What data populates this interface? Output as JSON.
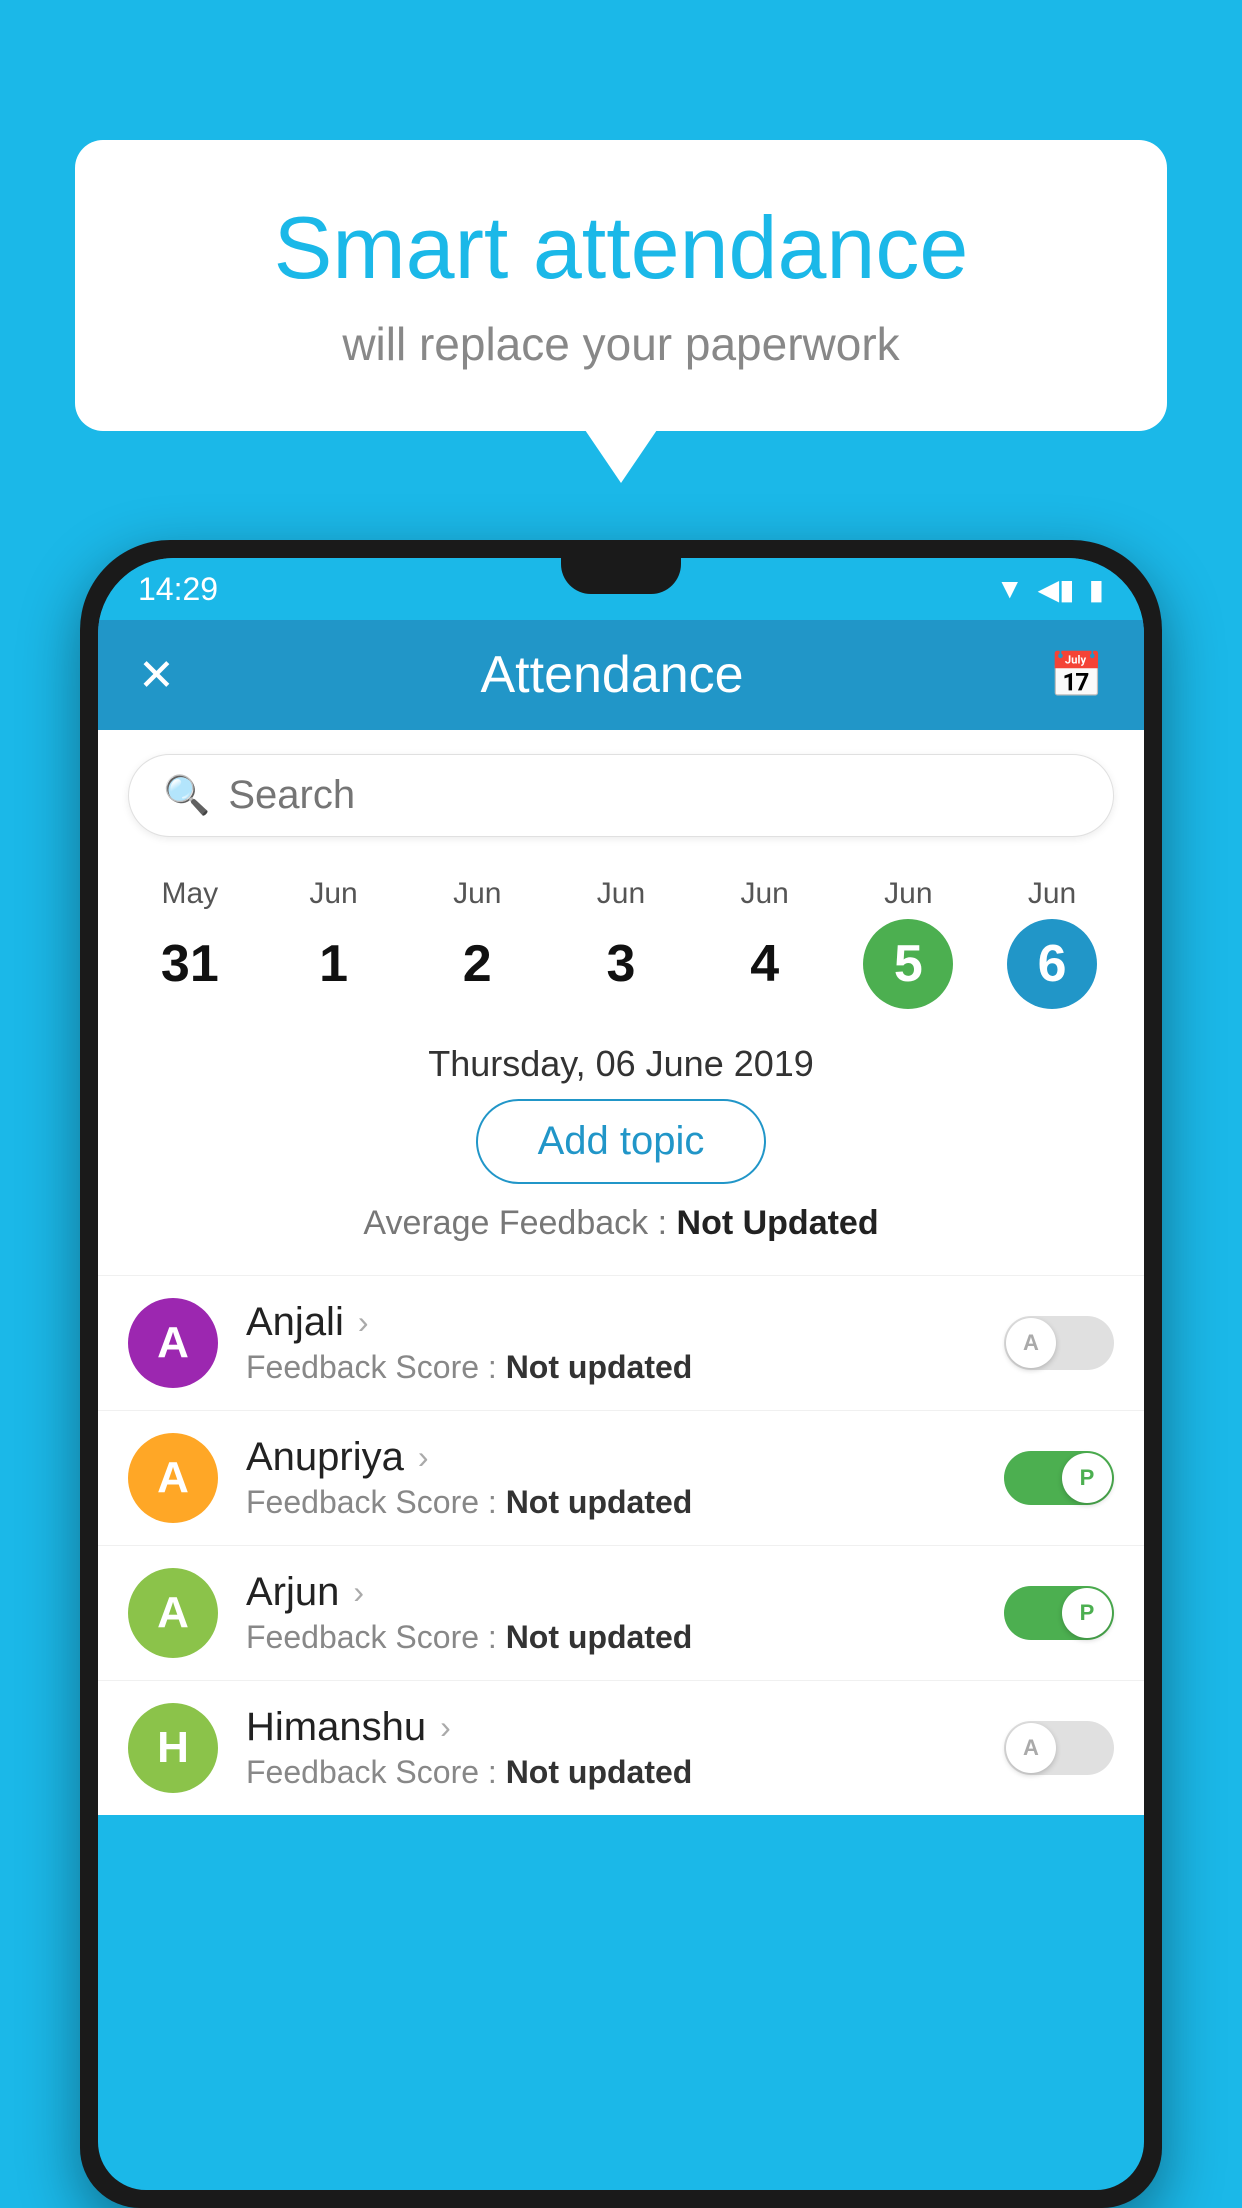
{
  "background_color": "#1BB8E8",
  "bubble": {
    "title": "Smart attendance",
    "subtitle": "will replace your paperwork"
  },
  "status_bar": {
    "time": "14:29",
    "wifi_icon": "▼",
    "signal_icon": "◀",
    "battery_icon": "▮"
  },
  "app_bar": {
    "title": "Attendance",
    "close_label": "✕",
    "calendar_label": "📅"
  },
  "search": {
    "placeholder": "Search"
  },
  "calendar": {
    "days": [
      {
        "month": "May",
        "num": "31",
        "state": "normal"
      },
      {
        "month": "Jun",
        "num": "1",
        "state": "normal"
      },
      {
        "month": "Jun",
        "num": "2",
        "state": "normal"
      },
      {
        "month": "Jun",
        "num": "3",
        "state": "normal"
      },
      {
        "month": "Jun",
        "num": "4",
        "state": "normal"
      },
      {
        "month": "Jun",
        "num": "5",
        "state": "today"
      },
      {
        "month": "Jun",
        "num": "6",
        "state": "selected"
      }
    ]
  },
  "date_header": "Thursday, 06 June 2019",
  "add_topic_label": "Add topic",
  "avg_feedback_label": "Average Feedback :",
  "avg_feedback_value": "Not Updated",
  "students": [
    {
      "name": "Anjali",
      "avatar_letter": "A",
      "avatar_color": "#9C27B0",
      "feedback_label": "Feedback Score :",
      "feedback_value": "Not updated",
      "toggle_state": "off",
      "toggle_letter": "A"
    },
    {
      "name": "Anupriya",
      "avatar_letter": "A",
      "avatar_color": "#FFA726",
      "feedback_label": "Feedback Score :",
      "feedback_value": "Not updated",
      "toggle_state": "on",
      "toggle_letter": "P"
    },
    {
      "name": "Arjun",
      "avatar_letter": "A",
      "avatar_color": "#8BC34A",
      "feedback_label": "Feedback Score :",
      "feedback_value": "Not updated",
      "toggle_state": "on",
      "toggle_letter": "P"
    },
    {
      "name": "Himanshu",
      "avatar_letter": "H",
      "avatar_color": "#8BC34A",
      "feedback_label": "Feedback Score :",
      "feedback_value": "Not updated",
      "toggle_state": "off",
      "toggle_letter": "A"
    }
  ]
}
